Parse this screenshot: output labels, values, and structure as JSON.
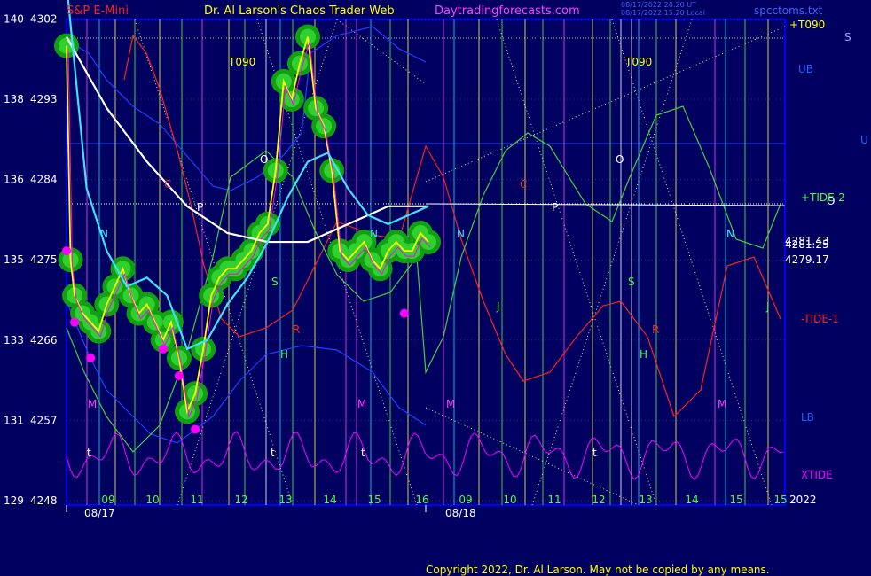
{
  "header": {
    "instrument": "S&P E-Mini",
    "site": "Dr. Al Larson's Chaos Trader Web",
    "url": "Daytradingforecasts.com",
    "timestamp_line1": "08/17/2022 20:20 UT",
    "timestamp_line2": "08/17/2022 15:20 Local",
    "file": "spcctoms.txt"
  },
  "footer": {
    "copyright": "Copyright 2022, Dr. Al Larson. May not be copied by any means."
  },
  "colors": {
    "background": "#000060",
    "frame": "#0000ff",
    "price": "#ffff00",
    "magenta": "#ff00ff",
    "green_glow": "#00c000",
    "white_ma": "#ffffff",
    "cyan_ma": "#40e0ff",
    "tide_plus": "#40ff40",
    "tide_minus": "#ff2020",
    "xtide": "#ff00ff",
    "bands": "#1c34ff"
  },
  "chart_data": {
    "type": "line",
    "title": "S&P E-Mini",
    "ylim": [
      4248,
      4310
    ],
    "y_ticks": [
      {
        "left": "140",
        "price": 4302
      },
      {
        "left": "138",
        "price": 4293
      },
      {
        "left": "136",
        "price": 4284
      },
      {
        "left": "135",
        "price": 4275
      },
      {
        "left": "133",
        "price": 4266
      },
      {
        "left": "131",
        "price": 4257
      },
      {
        "left": "129",
        "price": 4248
      }
    ],
    "x_hour_labels": [
      "09",
      "10",
      "11",
      "12",
      "13",
      "14",
      "15",
      "16",
      "09",
      "10",
      "11",
      "12",
      "13",
      "14",
      "15",
      "15"
    ],
    "date_labels": [
      "08/17",
      "08/18"
    ],
    "year_label": "2022",
    "right_labels": {
      "t090": "+T090",
      "ub": "UB",
      "tide2": "+TIDE-2",
      "price_a": "4281.43",
      "price_b": "4281.25",
      "price_c": "4279.17",
      "tide1": "-TIDE-1",
      "lb": "LB",
      "xtide": "XTIDE",
      "s": "S",
      "u": "U",
      "o": "O"
    },
    "annotations": [
      "T090",
      "T090",
      "O",
      "O",
      "P",
      "P",
      "N",
      "N",
      "N",
      "N",
      "S",
      "S",
      "H",
      "H",
      "J",
      "J",
      "M",
      "M",
      "M",
      "M",
      "M",
      "C",
      "C",
      "R",
      "R",
      "t",
      "t",
      "t",
      "t"
    ],
    "series": [
      {
        "name": "price",
        "x": [
          0,
          1,
          2,
          4,
          6,
          8,
          10,
          12,
          14,
          16,
          18,
          20,
          22,
          24,
          26,
          28,
          30,
          32,
          34,
          36,
          38,
          40,
          42,
          44,
          46,
          48,
          50,
          52,
          54,
          56,
          58,
          60,
          62,
          64,
          66,
          68,
          70,
          72,
          74,
          76,
          78,
          80,
          82,
          84,
          86,
          88,
          90
        ],
        "values": [
          4299,
          4275,
          4271,
          4269,
          4268,
          4267,
          4270,
          4272,
          4274,
          4271,
          4269,
          4270,
          4268,
          4266,
          4268,
          4264,
          4258,
          4260,
          4265,
          4271,
          4273,
          4274,
          4274,
          4275,
          4276,
          4278,
          4279,
          4285,
          4295,
          4293,
          4297,
          4300,
          4292,
          4290,
          4285,
          4276,
          4275,
          4276,
          4277,
          4275,
          4274,
          4276,
          4277,
          4276,
          4276,
          4278,
          4277
        ]
      },
      {
        "name": "white-ma",
        "x": [
          0,
          10,
          20,
          30,
          40,
          50,
          60,
          70,
          80,
          90
        ],
        "values": [
          4300,
          4292,
          4286,
          4281,
          4278,
          4277,
          4277,
          4279,
          4281,
          4281
        ]
      },
      {
        "name": "cyan-ma",
        "x": [
          0,
          5,
          10,
          15,
          20,
          25,
          30,
          35,
          40,
          45,
          50,
          55,
          60,
          65,
          70,
          75,
          80,
          85,
          90
        ],
        "values": [
          4306,
          4283,
          4276,
          4272,
          4273,
          4271,
          4265,
          4266,
          4270,
          4273,
          4277,
          4282,
          4286,
          4287,
          4283,
          4280,
          4279,
          4280,
          4281
        ]
      }
    ]
  }
}
